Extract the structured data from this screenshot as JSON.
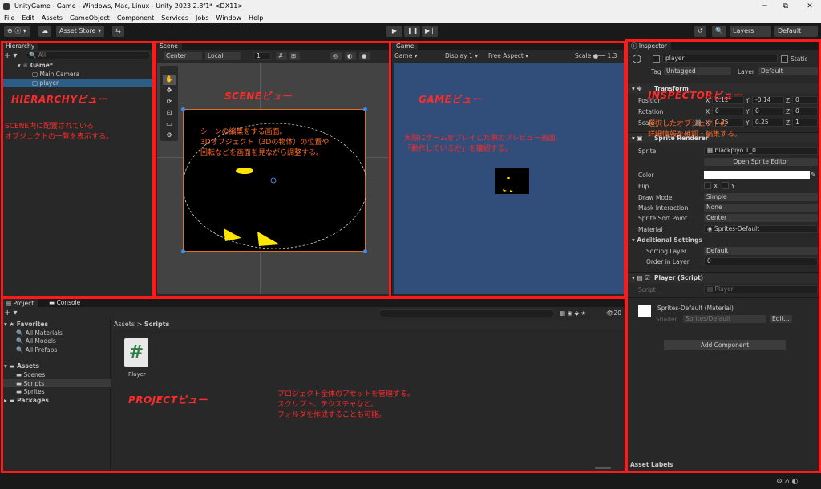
{
  "window": {
    "title": "UnityGame - Game - Windows, Mac, Linux - Unity 2023.2.8f1* <DX11>",
    "minimize": "─",
    "maximize": "⧉",
    "close": "✕"
  },
  "menu": [
    "File",
    "Edit",
    "Assets",
    "GameObject",
    "Component",
    "Services",
    "Jobs",
    "Window",
    "Help"
  ],
  "toolbar": {
    "account": "⊕ ⓐ ▾",
    "cloud": "☁",
    "asset_store": "Asset Store ▾",
    "collab": "⇆",
    "play": "▶",
    "pause": "❚❚",
    "step": "▶❘",
    "history": "↺",
    "search": "🔍",
    "layers": "Layers",
    "layout": "Default"
  },
  "hierarchy": {
    "tab": "Hierarchy",
    "add": "+ ▾",
    "search_placeholder": "All",
    "scene": "Game*",
    "items": [
      "Main Camera",
      "player"
    ]
  },
  "scene": {
    "tab": "Scene",
    "pivot": "Center",
    "space": "Local",
    "snap": "1"
  },
  "game": {
    "tab": "Game",
    "display_mode": "Game",
    "display": "Display 1",
    "aspect": "Free Aspect",
    "scale_label": "Scale",
    "scale_value": "1.3"
  },
  "inspector": {
    "tab": "Inspector",
    "object_name": "player",
    "static_label": "Static",
    "tag_label": "Tag",
    "tag_value": "Untagged",
    "layer_label": "Layer",
    "layer_value": "Default",
    "transform": {
      "title": "Transform",
      "rows": [
        {
          "label": "Position",
          "x": "0.12",
          "y": "-0.14",
          "z": "0"
        },
        {
          "label": "Rotation",
          "x": "0",
          "y": "0",
          "z": "0"
        },
        {
          "label": "Scale",
          "x": "0.25",
          "y": "0.25",
          "z": "1"
        }
      ]
    },
    "sprite_renderer": {
      "title": "Sprite Renderer",
      "sprite_label": "Sprite",
      "sprite_value": "blackpiyo 1_0",
      "open_editor": "Open Sprite Editor",
      "color_label": "Color",
      "flip_label": "Flip",
      "flip_x": "X",
      "flip_y": "Y",
      "draw_mode_label": "Draw Mode",
      "draw_mode": "Simple",
      "mask_label": "Mask Interaction",
      "mask": "None",
      "sort_point_label": "Sprite Sort Point",
      "sort_point": "Center",
      "material_label": "Material",
      "material": "Sprites-Default",
      "additional": "Additional Settings",
      "sorting_layer_label": "Sorting Layer",
      "sorting_layer": "Default",
      "order_label": "Order in Layer",
      "order": "0"
    },
    "script": {
      "title": "Player (Script)",
      "label": "Script",
      "value": "Player"
    },
    "material": {
      "name": "Sprites-Default (Material)",
      "shader_label": "Shader",
      "shader": "Sprites/Default",
      "edit": "Edit..."
    },
    "add_component": "Add Component",
    "asset_labels": "Asset Labels"
  },
  "project": {
    "tab_project": "Project",
    "tab_console": "Console",
    "add": "+ ▾",
    "count": "20",
    "favorites": "Favorites",
    "fav_items": [
      "All Materials",
      "All Models",
      "All Prefabs"
    ],
    "assets": "Assets",
    "asset_folders": [
      "Scenes",
      "Scripts",
      "Sprites"
    ],
    "packages": "Packages",
    "breadcrumb_root": "Assets",
    "breadcrumb_sep": ">",
    "breadcrumb_current": "Scripts",
    "file_name": "Player",
    "file_glyph": "#"
  },
  "annotations": {
    "hierarchy_title": "HIERARCHYビュー",
    "hierarchy_desc1": "SCENE内に配置されている",
    "hierarchy_desc2": "オブジェクトの一覧を表示する。",
    "scene_title": "SCENEビュー",
    "scene_desc1": "シーンの編集をする画面。",
    "scene_desc2": "3Dオブジェクト（3Dの物体）の位置や",
    "scene_desc3": "回転などを画面を見ながら調整する。",
    "game_title": "GAMEビュー",
    "game_desc1": "実際にゲームをプレイした際のプレビュー画面。",
    "game_desc2": "「動作しているか」を確認する。",
    "inspector_title": "INSPECTORビュー",
    "inspector_desc1": "選択したオブジェクトの",
    "inspector_desc2": "詳細情報を確認・編集する。",
    "project_title": "PROJECTビュー",
    "project_desc1": "プロジェクト全体のアセットを管理する。",
    "project_desc2": "スクリプト、テクスチャなど。",
    "project_desc3": "フォルダを作成することも可能。"
  },
  "colors": {
    "accent_red": "#ff1a1a",
    "selection": "#2c5d87",
    "game_bg": "#314d79"
  }
}
